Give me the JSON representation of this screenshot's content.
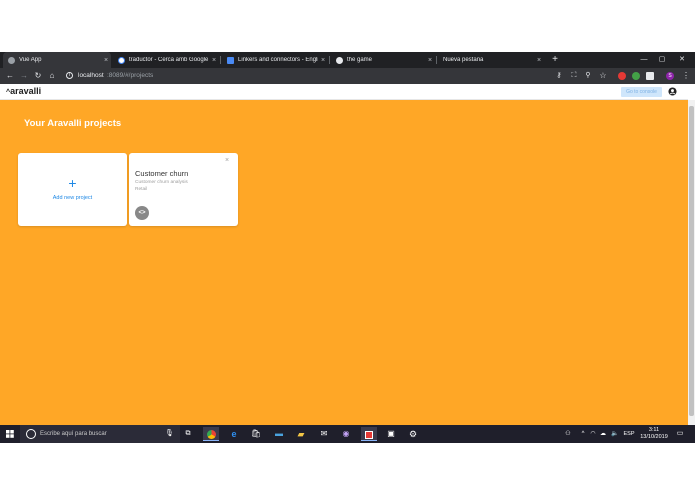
{
  "browser": {
    "tabs": [
      {
        "title": "Vue App",
        "icon": "globe-icon",
        "active": true
      },
      {
        "title": "traductor - Cerca amb Google",
        "icon": "google-icon",
        "active": false
      },
      {
        "title": "Linkers and connectors - English",
        "icon": "page-icon",
        "active": false
      },
      {
        "title": "the game",
        "icon": "globe-icon",
        "active": false
      },
      {
        "title": "Nueva pestaña",
        "icon": "none",
        "active": false
      }
    ],
    "tab_close": "×",
    "new_tab": "+",
    "window_controls": {
      "minimize": "—",
      "maximize": "▢",
      "close": "✕"
    },
    "url_host": "localhost",
    "url_path": ":8089/#/projects",
    "profile_initial": "S"
  },
  "app": {
    "logo": "aravalli",
    "go_to_console": "Go to console",
    "page_title": "Your Aravalli projects",
    "add_card": {
      "plus": "+",
      "label": "Add new project"
    },
    "projects": [
      {
        "name": "Customer churn",
        "description": "Customer churn analysis",
        "tag": "Retail",
        "close": "×",
        "code_icon": "<>"
      }
    ]
  },
  "taskbar": {
    "search_placeholder": "Escribe aquí para buscar",
    "tray_lang": "ESP",
    "time": "3:11",
    "date": "13/10/2019"
  },
  "colors": {
    "page_background": "#ffa726",
    "accent_blue": "#1e88e5",
    "console_button": "#cfe6fb"
  }
}
